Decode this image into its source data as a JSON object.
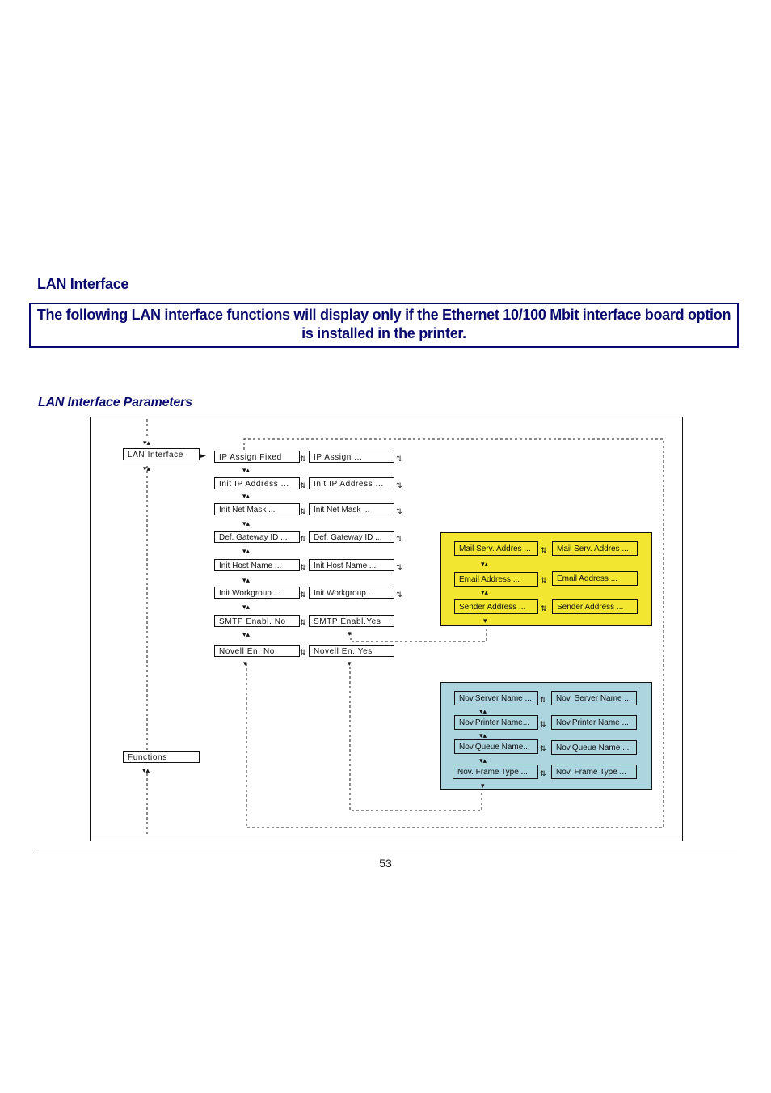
{
  "page": {
    "heading": "LAN Interface",
    "notice": "The following LAN interface functions will display only if the Ethernet 10/100 Mbit interface board option is installed in the printer.",
    "subheading": "LAN Interface Parameters",
    "page_number": "53"
  },
  "diagram": {
    "root": "LAN Interface",
    "functions": "Functions",
    "left_column": [
      "IP Assign Fixed",
      "Init IP Address ...",
      "Init Net Mask ...",
      "Def. Gateway ID ...",
      "Init  Host Name ...",
      "Init  Workgroup ...",
      "SMTP Enabl. No",
      "Novell En. No"
    ],
    "right_column": [
      "IP Assign ...",
      "Init IP Address ...",
      "Init Net Mask ...",
      "Def. Gateway ID ...",
      "Init  Host Name ...",
      "Init  Workgroup ...",
      "SMTP Enabl.Yes",
      "Novell En. Yes"
    ],
    "smtp_panel": {
      "color": "#f2e630",
      "left": [
        "Mail Serv. Addres ...",
        "Email Address ...",
        "Sender Address ..."
      ],
      "right": [
        "Mail Serv. Addres ...",
        "Email Address ...",
        "Sender Address ..."
      ]
    },
    "novell_panel": {
      "color": "#acd5e0",
      "left": [
        "Nov.Server Name ...",
        "Nov.Printer Name...",
        "Nov.Queue Name...",
        "Nov. Frame Type ..."
      ],
      "right": [
        "Nov. Server Name ...",
        "Nov.Printer Name ...",
        "Nov.Queue Name ...",
        "Nov. Frame Type ..."
      ]
    },
    "icons": {
      "up_down": "⇅",
      "left_right": "⇄",
      "arrow_right": "►",
      "arrow_down": "▼"
    }
  }
}
